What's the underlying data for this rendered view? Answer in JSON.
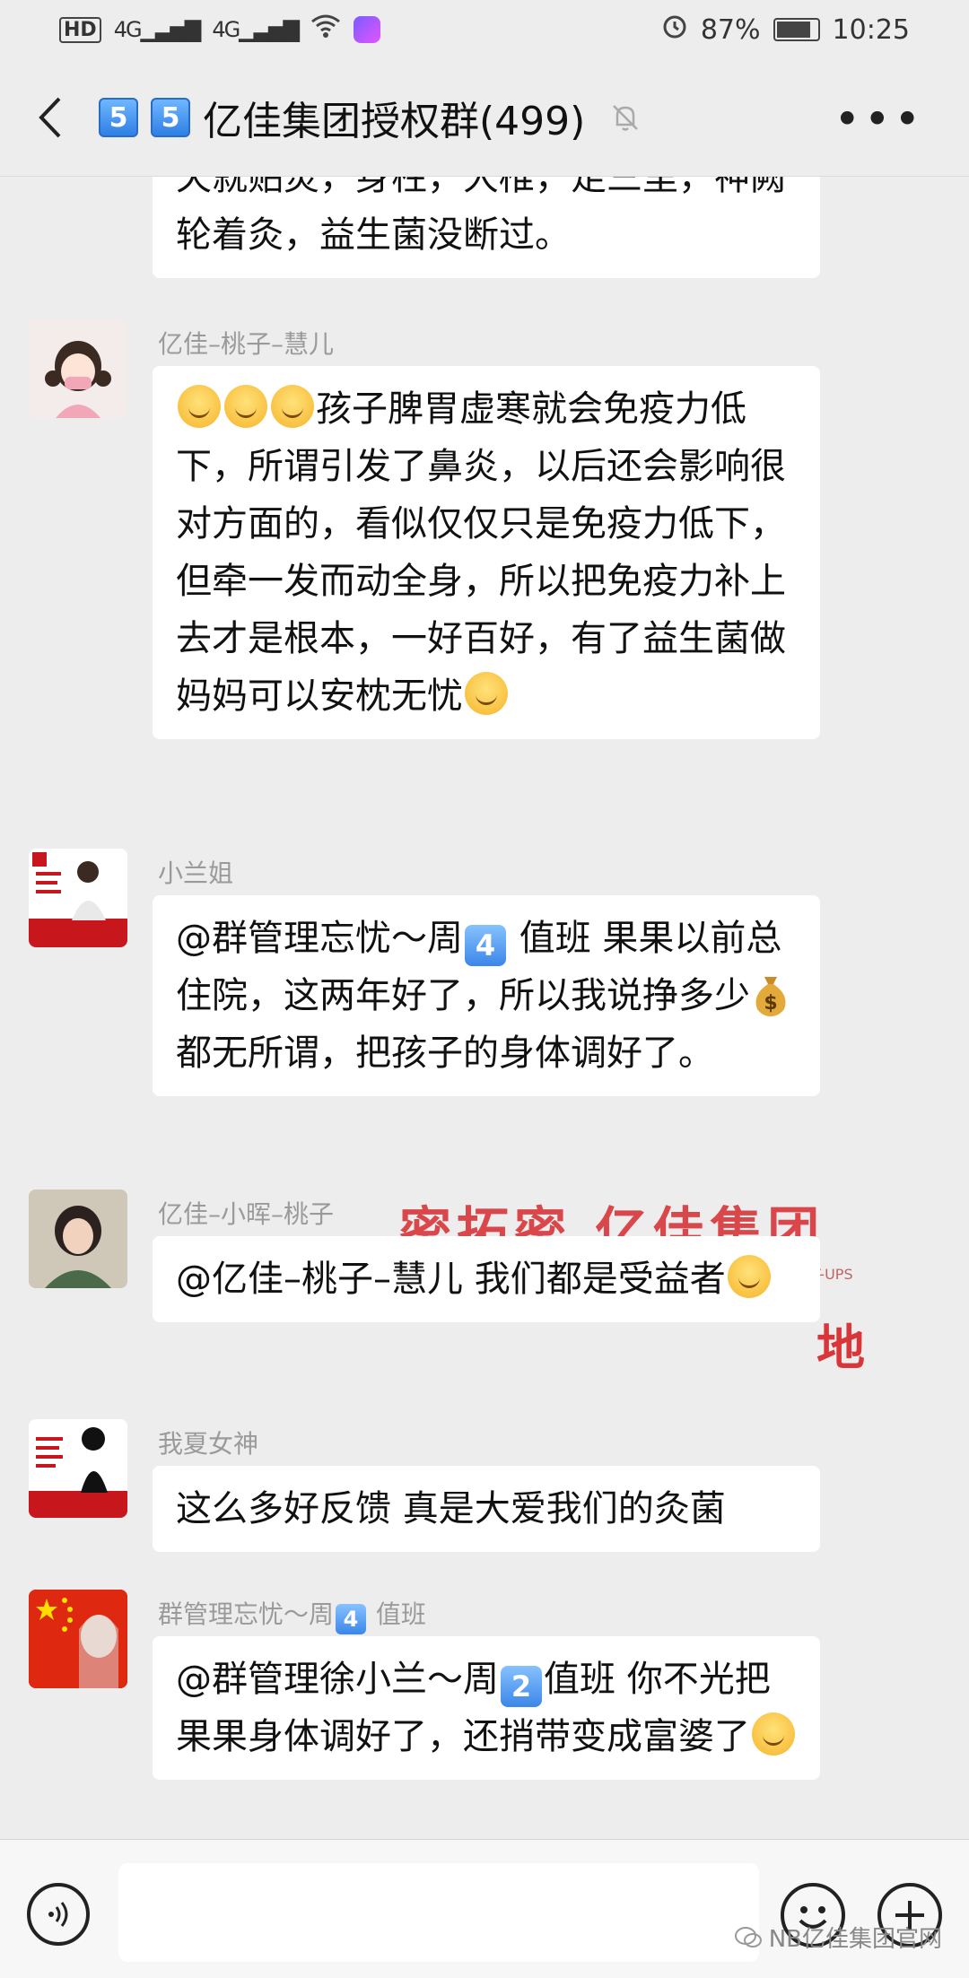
{
  "status_bar": {
    "hd": "HD",
    "sim1": "4G",
    "sim2": "4G",
    "battery": "87%",
    "time": "10:25"
  },
  "header": {
    "chip1": "5",
    "chip2": "5",
    "title": "亿佳集团授权群(499)"
  },
  "messages": {
    "m0": {
      "text": "天就贴灸，身柱，大椎，足三里，神阙轮着灸，益生菌没断过。"
    },
    "m1": {
      "sender": "亿佳–桃子–慧儿",
      "text": "孩子脾胃虚寒就会免疫力低下，所谓引发了鼻炎，以后还会影响很对方面的，看似仅仅只是免疫力低下，但牵一发而动全身，所以把免疫力补上去才是根本，一好百好，有了益生菌做妈妈可以安枕无忧"
    },
    "m2": {
      "sender": "小兰姐",
      "t1": "@群管理忘忧～周",
      "key": "4",
      "t2": " 值班 果果以前总住院，这两年好了，所以我说挣多少",
      "t3": " 都无所谓，把孩子的身体调好了。"
    },
    "m3": {
      "sender": "亿佳–小晖–桃子",
      "text": "@亿佳–桃子–慧儿  我们都是受益者"
    },
    "m4": {
      "sender": "我夏女神",
      "text": "这么多好反馈 真是大爱我们的灸菌"
    },
    "m5": {
      "sender_a": "群管理忘忧～周",
      "sender_key": "4",
      "sender_b": " 值班",
      "t1": "@群管理徐小兰～周",
      "key": "2",
      "t2": "值班 你不光把果果身体调好了，还捎带变成富婆了"
    }
  },
  "watermark": {
    "line1": "密拓密  亿佳集团",
    "line2": "地",
    "small": "T-UPS"
  },
  "credit": "NB亿佳集团官网"
}
